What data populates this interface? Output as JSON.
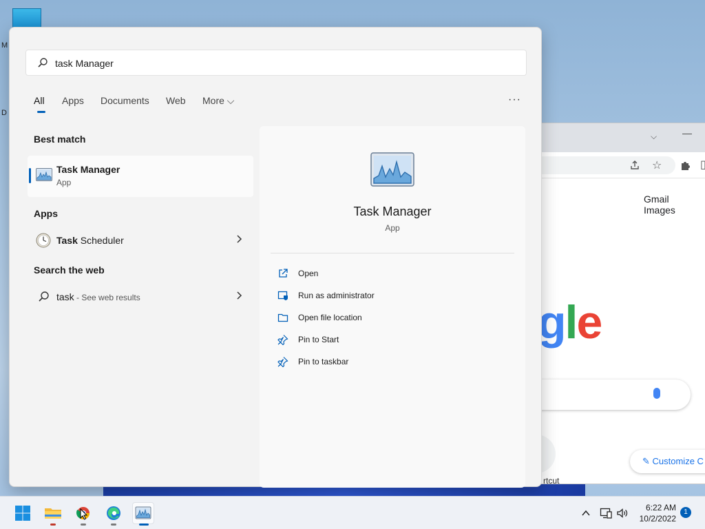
{
  "desktop": {
    "icon_letters": [
      "M",
      "D"
    ]
  },
  "browser": {
    "header_links": [
      "Gmail",
      "Images"
    ],
    "logo_fragment": [
      {
        "char": "g",
        "color": "#4285f4"
      },
      {
        "char": "l",
        "color": "#34a853"
      },
      {
        "char": "e",
        "color": "#ea4335"
      }
    ],
    "customize_label": "Customize C",
    "shortcut_fragment": "rtcut"
  },
  "search": {
    "query": "task Manager"
  },
  "tabs": [
    {
      "label": "All",
      "active": true
    },
    {
      "label": "Apps"
    },
    {
      "label": "Documents"
    },
    {
      "label": "Web"
    },
    {
      "label": "More ⌵"
    }
  ],
  "more_options": "···",
  "sections": {
    "best_match": "Best match",
    "apps": "Apps",
    "search_web": "Search the web"
  },
  "best_match": {
    "name": "Task Manager",
    "type": "App"
  },
  "apps": [
    {
      "bold": "Task",
      "rest": " Scheduler"
    }
  ],
  "web": {
    "term": "task",
    "suffix": " - See web results"
  },
  "detail": {
    "name": "Task Manager",
    "type": "App",
    "actions": [
      {
        "label": "Open",
        "icon": "open-external-icon"
      },
      {
        "label": "Run as administrator",
        "icon": "shield-admin-icon"
      },
      {
        "label": "Open file location",
        "icon": "folder-icon"
      },
      {
        "label": "Pin to Start",
        "icon": "pin-icon"
      },
      {
        "label": "Pin to taskbar",
        "icon": "pin-icon"
      }
    ]
  },
  "taskbar": {
    "time": "6:22 AM",
    "date": "10/2/2022",
    "notification_count": "1",
    "accent": "#005fb8"
  }
}
